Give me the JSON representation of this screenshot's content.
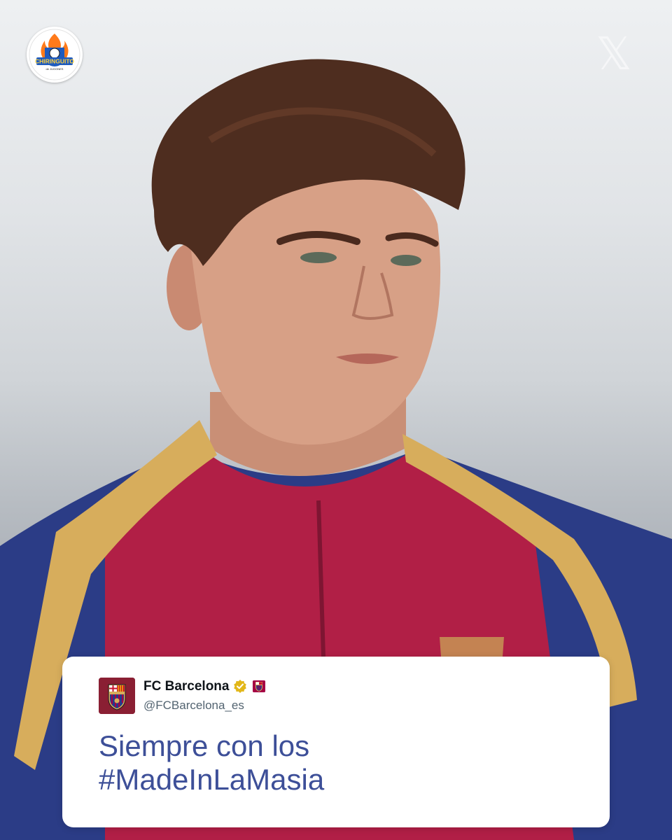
{
  "brand": {
    "logo_icon": "chiringuito-logo-icon",
    "logo_text": "CHIRINGUITO",
    "logo_subtext": "de JUGONES"
  },
  "platform": {
    "icon": "x-logo-icon",
    "glyph": "𝕏"
  },
  "tweet": {
    "display_name": "FC Barcelona",
    "handle": "@FCBarcelona_es",
    "text_line1": "Siempre con los",
    "text_line2": "#MadeInLaMasia",
    "verified_icon": "verified-badge-icon",
    "flag_icon": "barca-flag-icon",
    "avatar_icon": "fc-barcelona-crest-icon"
  },
  "colors": {
    "tweet_text": "#3d4f98",
    "barca_blue": "#1f3c8f",
    "barca_garnet": "#a50044",
    "gold": "#d7ad5c",
    "verified": "#e2b719"
  }
}
